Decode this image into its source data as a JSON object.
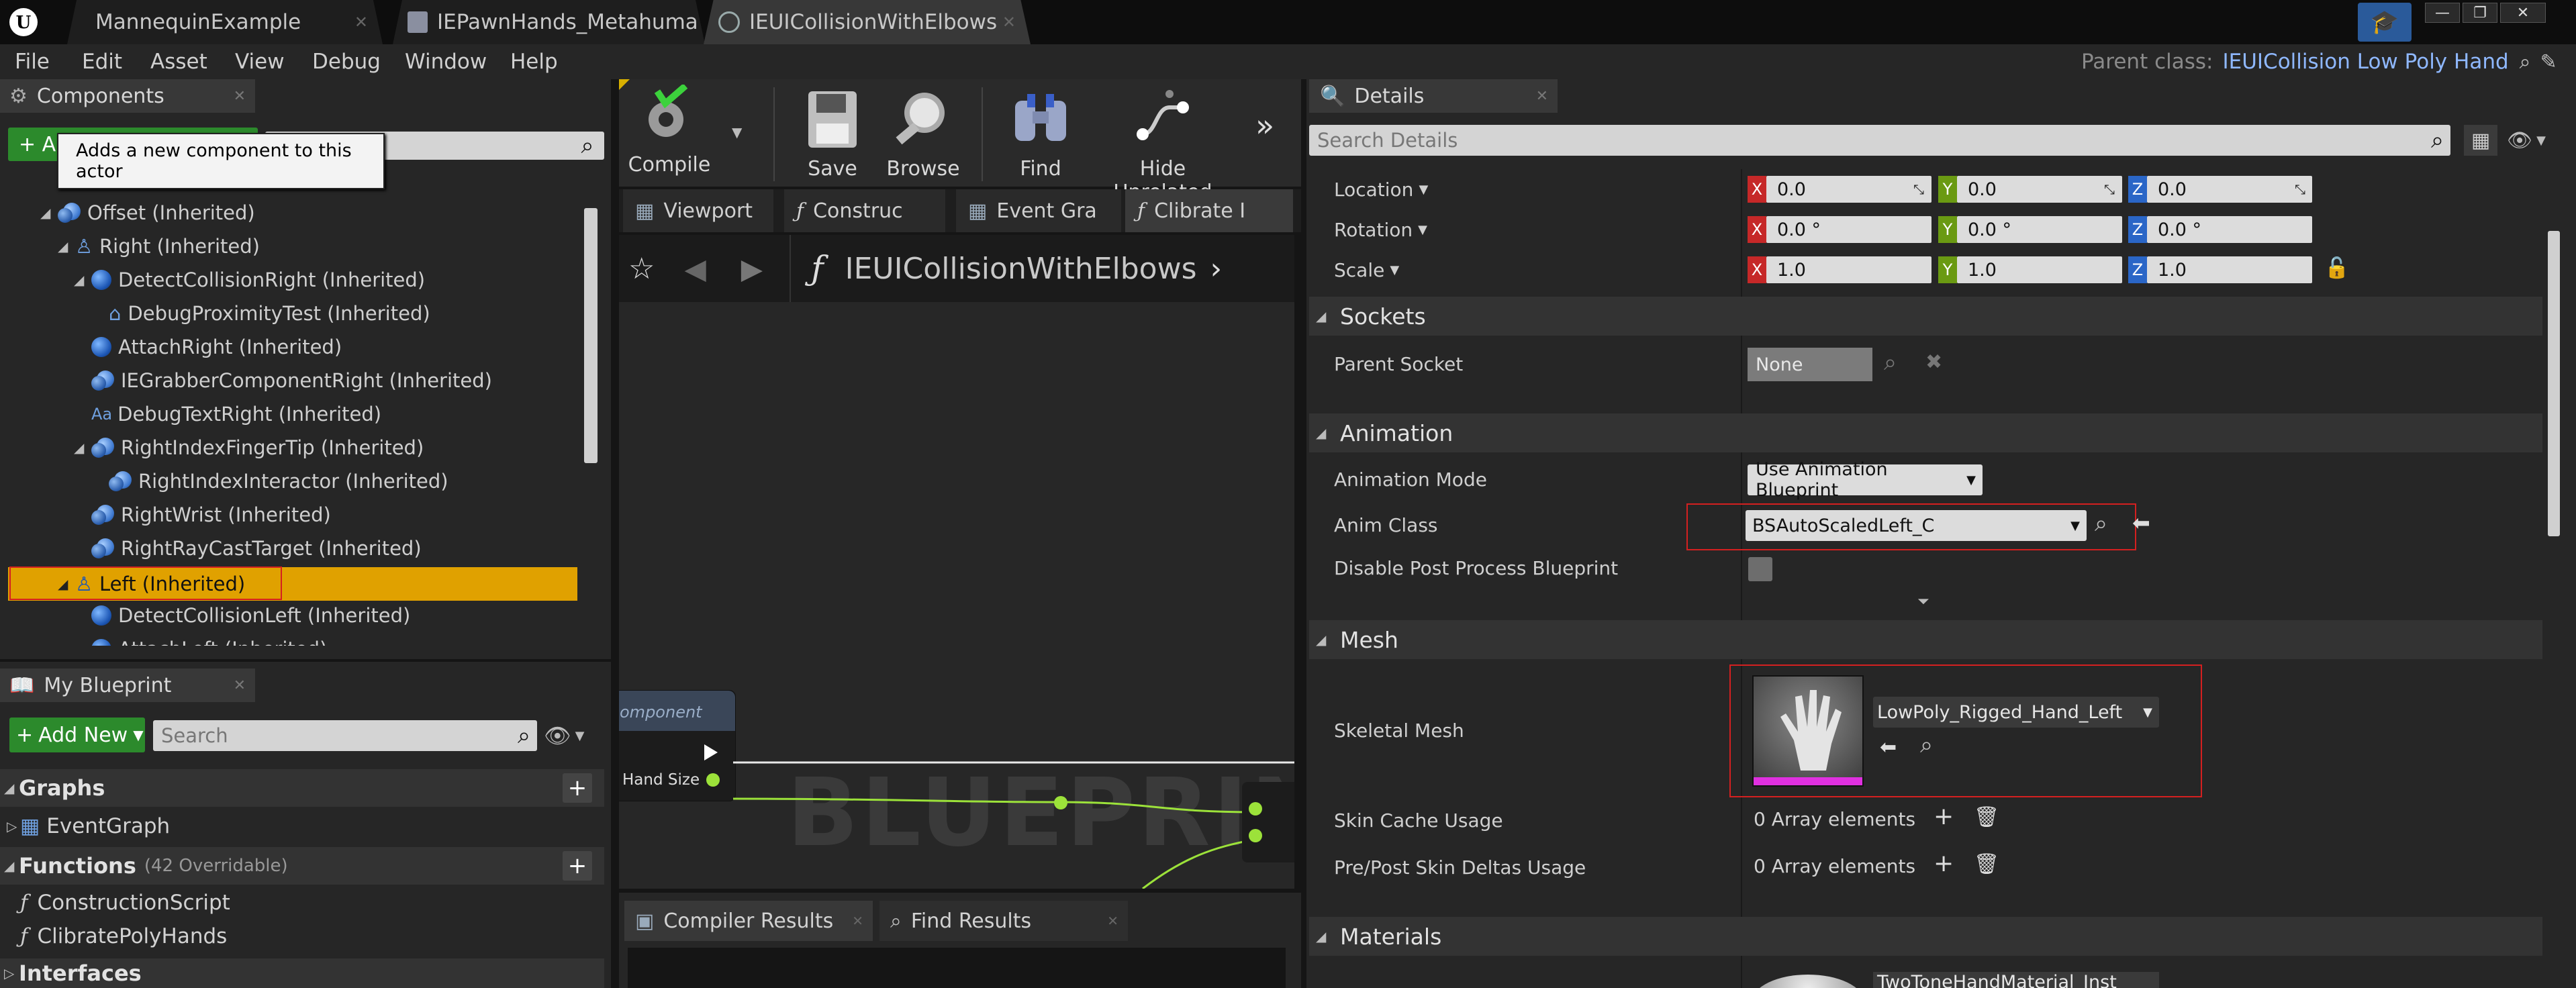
{
  "window": {
    "tabs": [
      {
        "label": "MannequinExample"
      },
      {
        "label": "IEPawnHands_Metahuma"
      },
      {
        "label": "IEUICollisionWithElbows"
      }
    ],
    "parent_class_label": "Parent class:",
    "parent_class_value": "IEUICollision Low Poly Hand"
  },
  "menu": [
    "File",
    "Edit",
    "Asset",
    "View",
    "Debug",
    "Window",
    "Help"
  ],
  "components": {
    "title": "Components",
    "add_button": "+ A",
    "tooltip": "Adds a new component to this actor",
    "items": [
      "Offset (Inherited)",
      "Right (Inherited)",
      "DetectCollisionRight (Inherited)",
      "DebugProximityTest (Inherited)",
      "AttachRight (Inherited)",
      "IEGrabberComponentRight (Inherited)",
      "DebugTextRight (Inherited)",
      "RightIndexFingerTip (Inherited)",
      "RightIndexInteractor (Inherited)",
      "RightWrist (Inherited)",
      "RightRayCastTarget (Inherited)",
      "Left (Inherited)",
      "DetectCollisionLeft (Inherited)",
      "AttachLeft (Inherited)"
    ]
  },
  "my_blueprint": {
    "title": "My Blueprint",
    "add_new": "Add New",
    "search_placeholder": "Search",
    "graphs_label": "Graphs",
    "event_graph": "EventGraph",
    "functions_label": "Functions",
    "functions_count": "(42 Overridable)",
    "construction_script": "ConstructionScript",
    "clibrate_poly_hands": "ClibratePolyHands",
    "interfaces_label": "Interfaces"
  },
  "toolbar": {
    "compile": "Compile",
    "save": "Save",
    "browse": "Browse",
    "find": "Find",
    "hide_unrelated": "Hide Unrelated"
  },
  "editor_tabs": [
    "Viewport",
    "Construc",
    "Event Gra",
    "Clibrate I"
  ],
  "graph": {
    "breadcrumb": "IEUICollisionWithElbows",
    "node_title": "omponent",
    "pin_label": "Hand Size",
    "watermark": "BLUEPRINT"
  },
  "bottom_tabs": {
    "compiler_results": "Compiler Results",
    "find_results": "Find Results"
  },
  "details": {
    "title": "Details",
    "search_placeholder": "Search Details",
    "location_label": "Location",
    "rotation_label": "Rotation",
    "scale_label": "Scale",
    "location": {
      "x": "0.0",
      "y": "0.0",
      "z": "0.0"
    },
    "rotation": {
      "x": "0.0 °",
      "y": "0.0 °",
      "z": "0.0 °"
    },
    "scale": {
      "x": "1.0",
      "y": "1.0",
      "z": "1.0"
    },
    "axis_x": "X",
    "axis_y": "Y",
    "axis_z": "Z",
    "sockets_section": "Sockets",
    "parent_socket_label": "Parent Socket",
    "parent_socket_value": "None",
    "animation_section": "Animation",
    "animation_mode_label": "Animation Mode",
    "animation_mode_value": "Use Animation Blueprint",
    "anim_class_label": "Anim Class",
    "anim_class_value": "BSAutoScaledLeft_C",
    "disable_post_process_label": "Disable Post Process Blueprint",
    "mesh_section": "Mesh",
    "skeletal_mesh_label": "Skeletal Mesh",
    "skeletal_mesh_value": "LowPoly_Rigged_Hand_Left",
    "skin_cache_label": "Skin Cache Usage",
    "skin_cache_value": "0 Array elements",
    "pre_post_label": "Pre/Post Skin Deltas Usage",
    "pre_post_value": "0 Array elements",
    "materials_section": "Materials",
    "material_value": "TwoToneHandMaterial_Inst"
  },
  "colors": {
    "selection": "#e0a100",
    "highlight_box": "#d42020",
    "axis_x": "#c62828",
    "axis_y": "#6a9a12",
    "axis_z": "#2a66c7",
    "link_blue": "#8fb8ff"
  }
}
